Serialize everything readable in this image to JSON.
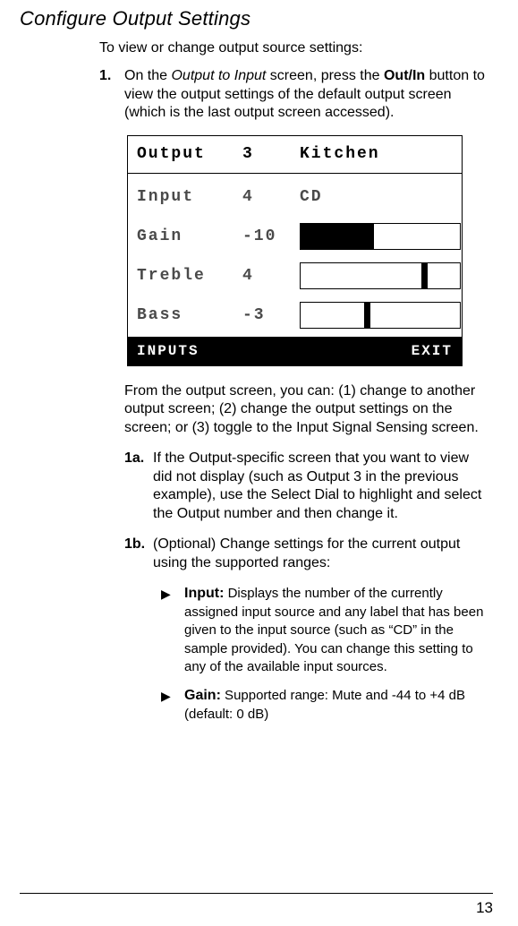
{
  "section_title": "Configure Output Settings",
  "intro": "To view or change output source settings:",
  "step1": {
    "num": "1.",
    "pre": "On the ",
    "screen_name": "Output to Input",
    "mid": " screen, press the ",
    "button_name": "Out/In",
    "post": " button to view the output settings of the default output screen (which is the last output screen accessed)."
  },
  "device": {
    "header": {
      "label": "Output",
      "num": "3",
      "name": "Kitchen"
    },
    "rows": {
      "input": {
        "label": "Input",
        "value": "4",
        "text": "CD"
      },
      "gain": {
        "label": "Gain",
        "value": "-10"
      },
      "treble": {
        "label": "Treble",
        "value": "4"
      },
      "bass": {
        "label": "Bass",
        "value": "-3"
      }
    },
    "footer": {
      "left": "INPUTS",
      "right": "EXIT"
    }
  },
  "para_after_device": "From the output screen, you can: (1) change to another output screen; (2) change the output settings on the screen; or (3) toggle to the Input Signal Sensing screen.",
  "step1a": {
    "num": "1a.",
    "text": "If the Output-specific screen that you want to view did not display (such as Output 3 in the previous example), use the Select Dial to highlight and select the Output number and then change it."
  },
  "step1b": {
    "num": "1b.",
    "text": "(Optional) Change settings for the current output using the supported ranges:"
  },
  "bullets": {
    "input": {
      "title": "Input:",
      "text": " Displays the number of the currently assigned input source and any label that has been given to the input source (such as “CD” in the sample provided). You can change this setting to any of the available input sources."
    },
    "gain": {
      "title": "Gain:",
      "text": " Supported range: Mute and -44 to +4 dB (default: 0 dB)"
    }
  },
  "page_number": "13"
}
